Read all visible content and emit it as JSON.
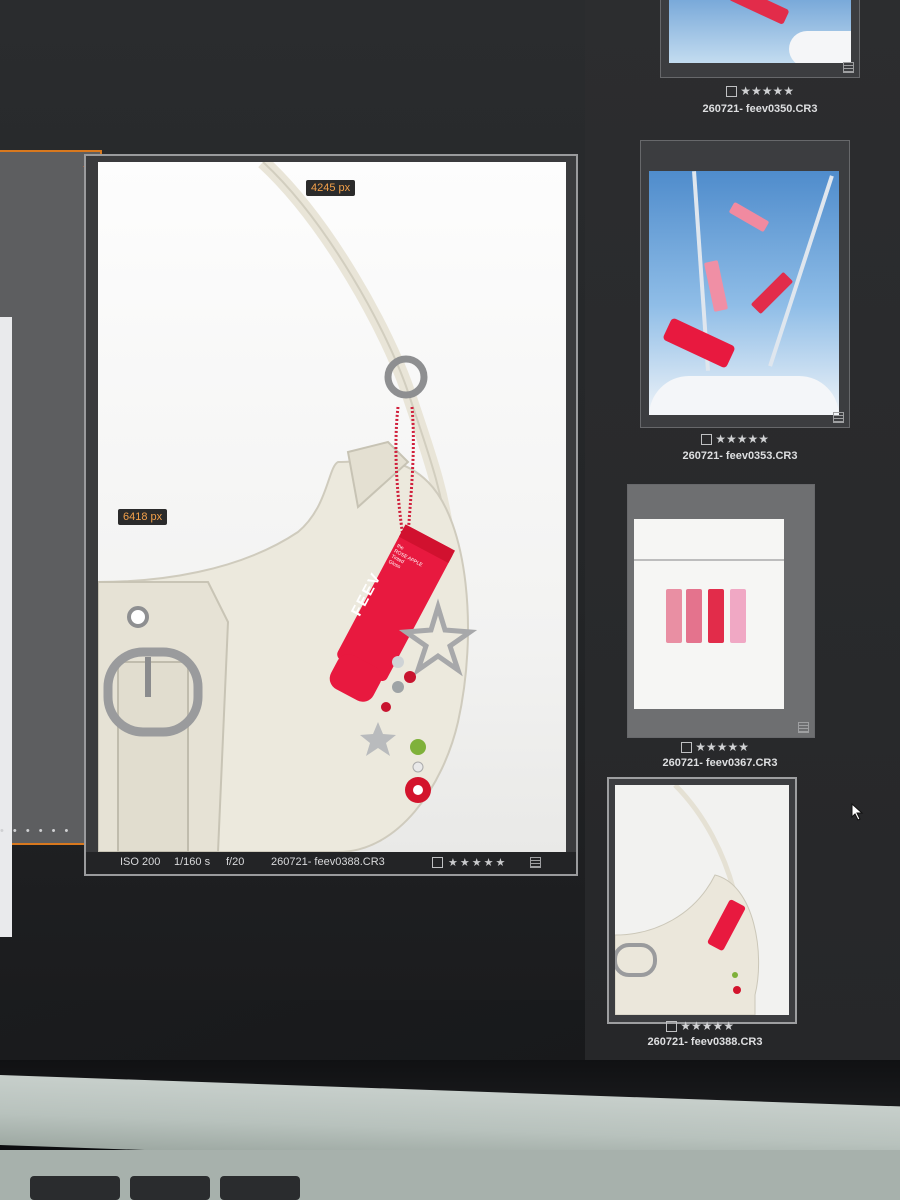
{
  "main_photo": {
    "width_label": "4245 px",
    "height_label": "6418 px",
    "iso": "ISO 200",
    "shutter": "1/160 s",
    "aperture": "f/20",
    "filename": "260721- feev0388.CR3",
    "rating": "★★★★★",
    "product_brand": "FEEV",
    "product_line1": "the",
    "product_line2": "ROSE APPLE",
    "product_line3": "Tinted",
    "product_line4": "Gloss"
  },
  "prev_photo": {
    "dots": "• • • • • •"
  },
  "filmstrip": [
    {
      "filename": "260721- feev0350.CR3",
      "rating": "★★★★★"
    },
    {
      "filename": "260721- feev0353.CR3",
      "rating": "★★★★★"
    },
    {
      "filename": "260721- feev0367.CR3",
      "rating": "★★★★★"
    },
    {
      "filename": "260721- feev0388.CR3",
      "rating": "★★★★★"
    }
  ],
  "colors": {
    "selection_accent": "#d8781e",
    "badge_text": "#f3a04a",
    "product_red": "#e8193f"
  }
}
